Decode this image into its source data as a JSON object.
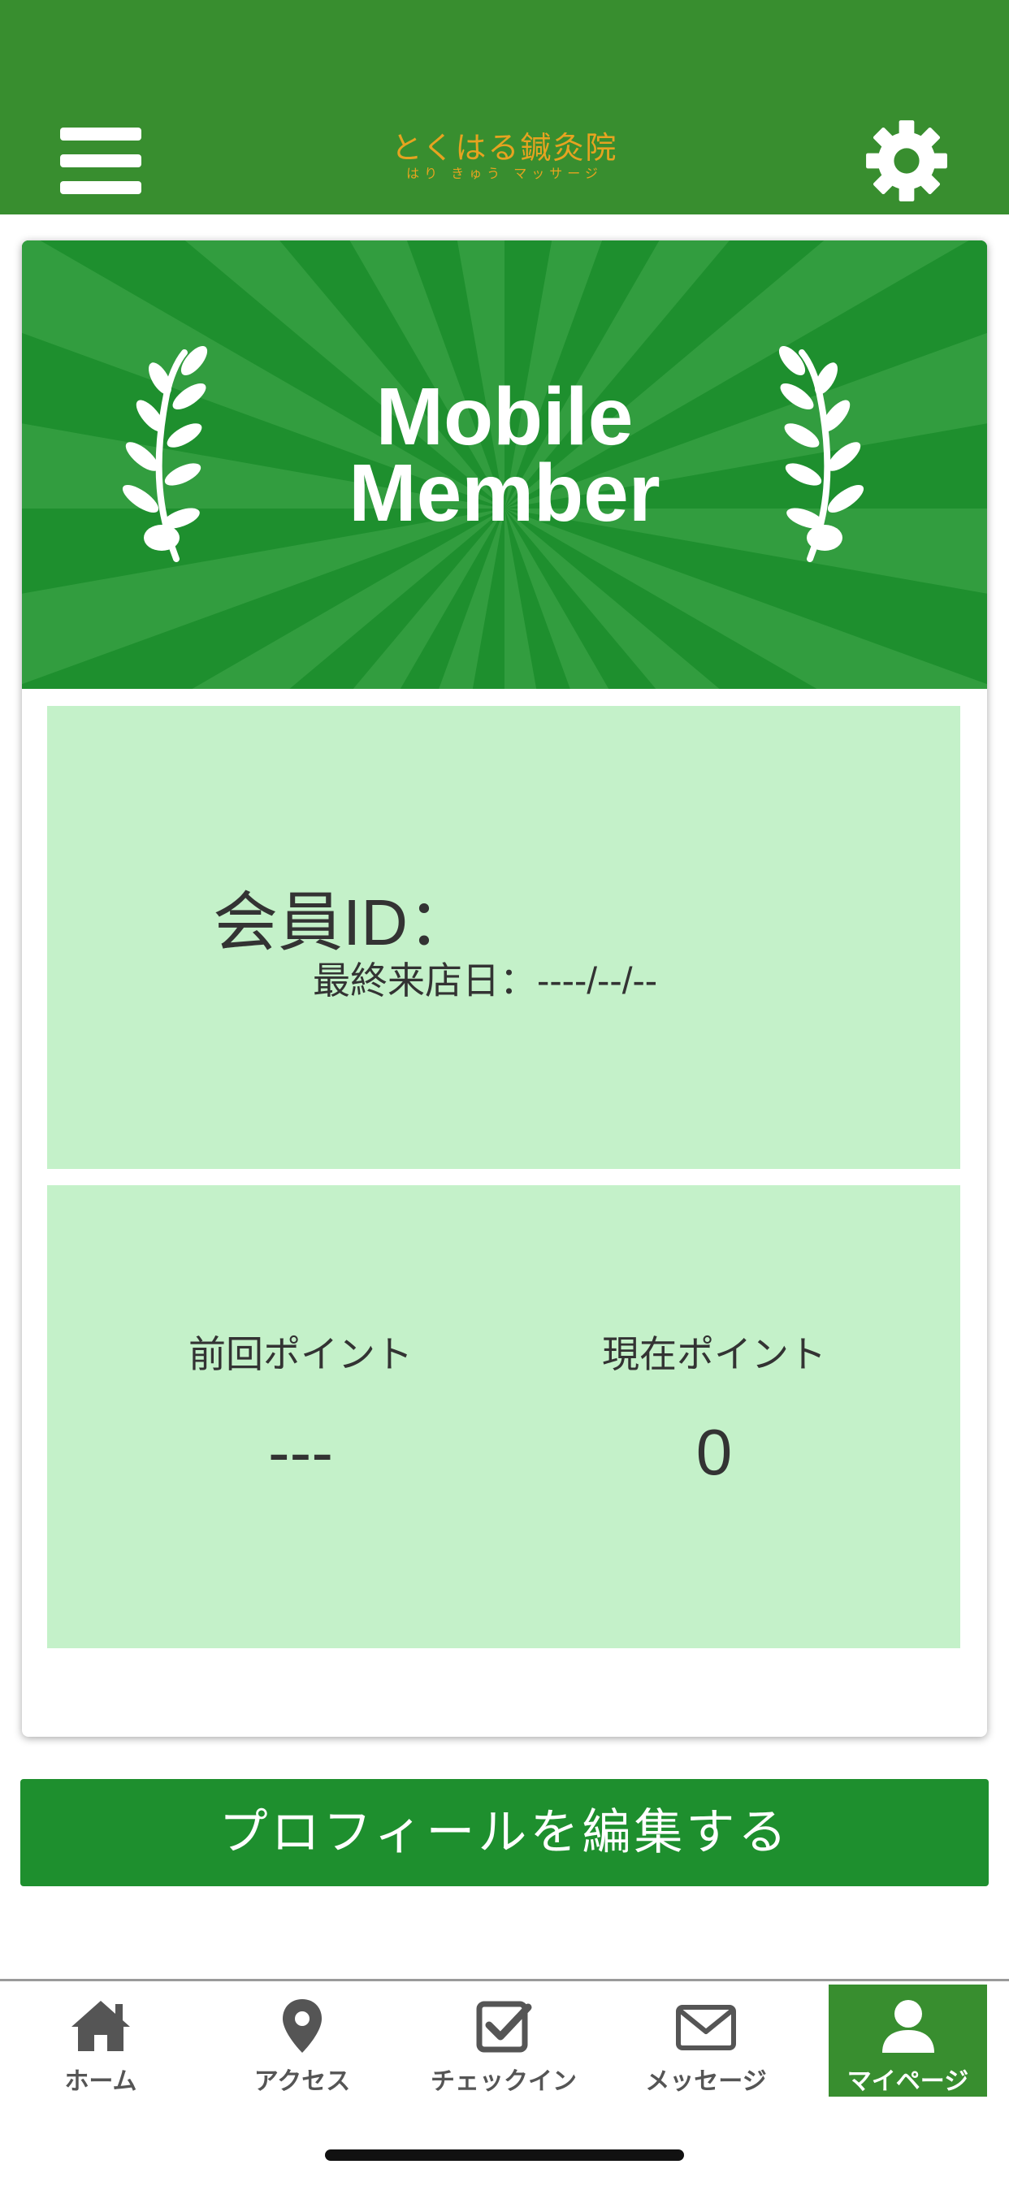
{
  "header": {
    "logo_main": "とくはる鍼灸院",
    "logo_sub": "はり きゅう マッサージ",
    "menu_icon": "hamburger-menu-icon",
    "settings_icon": "gear-icon"
  },
  "banner": {
    "title_line1": "Mobile",
    "title_line2": "Member"
  },
  "member_info": {
    "member_id_label": "会員ID：",
    "last_visit_label": "最終来店日：",
    "last_visit_value": "----/--/--"
  },
  "points": {
    "previous_label": "前回ポイント",
    "previous_value": "---",
    "current_label": "現在ポイント",
    "current_value": "0"
  },
  "edit_profile_label": "プロフィールを編集する",
  "tabbar": {
    "tabs": [
      {
        "label": "ホーム",
        "icon": "home-icon"
      },
      {
        "label": "アクセス",
        "icon": "map-pin-icon"
      },
      {
        "label": "チェックイン",
        "icon": "checkbox-icon"
      },
      {
        "label": "メッセージ",
        "icon": "envelope-icon"
      },
      {
        "label": "マイページ",
        "icon": "user-icon",
        "active": true
      }
    ]
  },
  "colors": {
    "header_green": "#388e2f",
    "banner_green": "#1e8f2e",
    "panel_mint": "#c4f1c9",
    "logo_gold": "#e6a320"
  }
}
